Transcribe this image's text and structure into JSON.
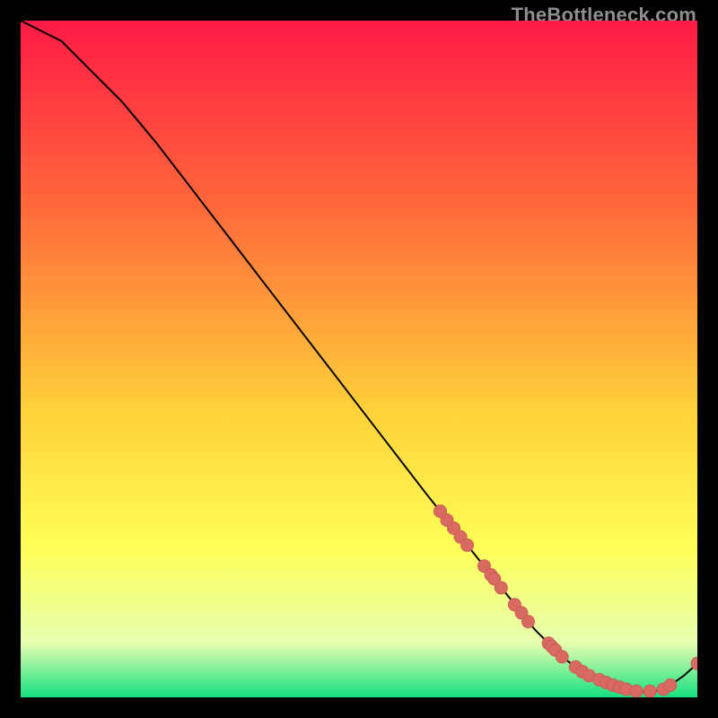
{
  "watermark": "TheBottleneck.com",
  "colors": {
    "gradient_top": "#ff1a46",
    "gradient_mid1": "#ff6a3a",
    "gradient_mid2": "#ffd23a",
    "gradient_mid3": "#ffff58",
    "gradient_low": "#e6ffb0",
    "gradient_bottom": "#15e080",
    "line": "#000000",
    "dot_fill": "#d86a62",
    "dot_stroke": "#cc5d56"
  },
  "chart_data": {
    "type": "line",
    "title": "",
    "xlabel": "",
    "ylabel": "",
    "xlim": [
      0,
      100
    ],
    "ylim": [
      0,
      100
    ],
    "series": [
      {
        "name": "curve",
        "x": [
          0,
          2,
          4,
          6,
          8,
          10,
          12,
          15,
          20,
          25,
          30,
          35,
          40,
          45,
          50,
          55,
          60,
          62,
          64,
          66,
          68,
          70,
          72,
          74,
          76,
          78,
          80,
          82,
          84,
          86,
          88,
          90,
          92,
          94,
          96,
          98,
          100
        ],
        "y": [
          100,
          99,
          98,
          97,
          95,
          93,
          91,
          88,
          82,
          75.5,
          69,
          62.5,
          56,
          49.5,
          43,
          36.5,
          30,
          27.5,
          25,
          22.5,
          20,
          17.5,
          15,
          12.5,
          10,
          8,
          6,
          4.5,
          3.2,
          2.2,
          1.5,
          1.0,
          0.8,
          1.0,
          1.8,
          3.2,
          5.0
        ]
      }
    ],
    "scatter": [
      {
        "x": 62.0,
        "y": 27.5
      },
      {
        "x": 63.0,
        "y": 26.2
      },
      {
        "x": 64.0,
        "y": 25.0
      },
      {
        "x": 65.0,
        "y": 23.7
      },
      {
        "x": 66.0,
        "y": 22.5
      },
      {
        "x": 68.5,
        "y": 19.4
      },
      {
        "x": 69.5,
        "y": 18.1
      },
      {
        "x": 70.0,
        "y": 17.5
      },
      {
        "x": 71.0,
        "y": 16.2
      },
      {
        "x": 73.0,
        "y": 13.7
      },
      {
        "x": 74.0,
        "y": 12.5
      },
      {
        "x": 75.0,
        "y": 11.2
      },
      {
        "x": 78.0,
        "y": 8.0
      },
      {
        "x": 78.5,
        "y": 7.5
      },
      {
        "x": 79.0,
        "y": 7.0
      },
      {
        "x": 80.0,
        "y": 6.0
      },
      {
        "x": 82.0,
        "y": 4.5
      },
      {
        "x": 83.0,
        "y": 3.8
      },
      {
        "x": 84.0,
        "y": 3.2
      },
      {
        "x": 85.5,
        "y": 2.6
      },
      {
        "x": 86.5,
        "y": 2.2
      },
      {
        "x": 87.5,
        "y": 1.8
      },
      {
        "x": 88.5,
        "y": 1.5
      },
      {
        "x": 89.5,
        "y": 1.2
      },
      {
        "x": 91.0,
        "y": 0.9
      },
      {
        "x": 93.0,
        "y": 0.9
      },
      {
        "x": 95.0,
        "y": 1.2
      },
      {
        "x": 96.0,
        "y": 1.8
      },
      {
        "x": 100.0,
        "y": 5.0
      }
    ]
  }
}
